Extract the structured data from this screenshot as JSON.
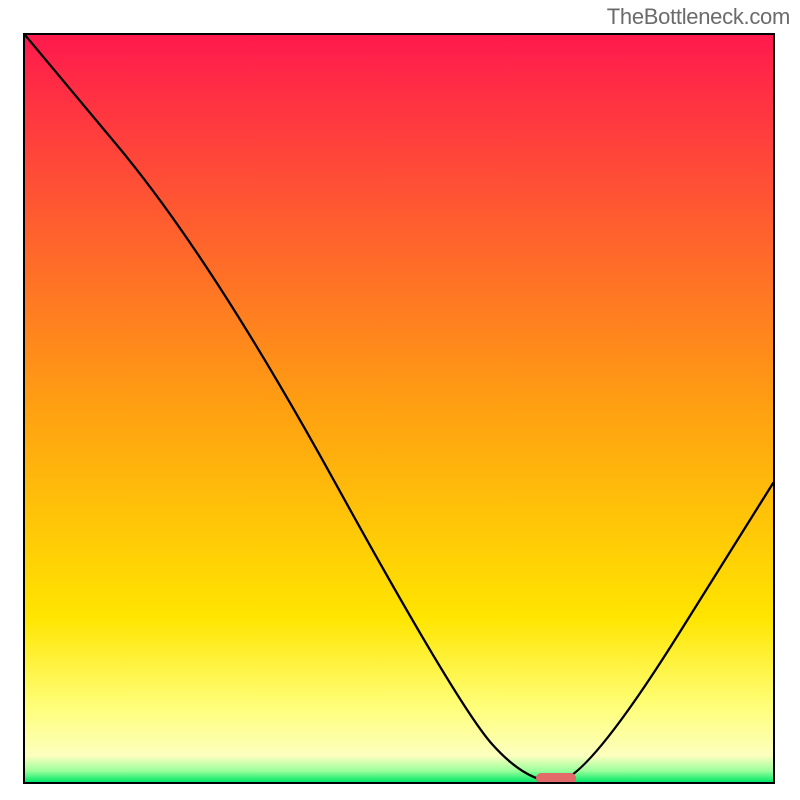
{
  "attribution": "TheBottleneck.com",
  "chart_data": {
    "type": "line",
    "title": "",
    "xlabel": "",
    "ylabel": "",
    "xlim": [
      0,
      100
    ],
    "ylim": [
      0,
      100
    ],
    "curve": [
      {
        "x": 0,
        "y": 100
      },
      {
        "x": 25,
        "y": 70
      },
      {
        "x": 58,
        "y": 10
      },
      {
        "x": 67,
        "y": 0
      },
      {
        "x": 75,
        "y": 0
      },
      {
        "x": 100,
        "y": 40
      }
    ],
    "marker": {
      "x": 71,
      "y": 0
    },
    "gradient_bands": [
      {
        "offset": 0.0,
        "color": "#ff1a4d"
      },
      {
        "offset": 0.5,
        "color": "#ffa011"
      },
      {
        "offset": 0.78,
        "color": "#ffe500"
      },
      {
        "offset": 0.9,
        "color": "#ffff7a"
      },
      {
        "offset": 0.965,
        "color": "#fcffbe"
      },
      {
        "offset": 0.985,
        "color": "#9cff9c"
      },
      {
        "offset": 1.0,
        "color": "#00e868"
      }
    ]
  }
}
